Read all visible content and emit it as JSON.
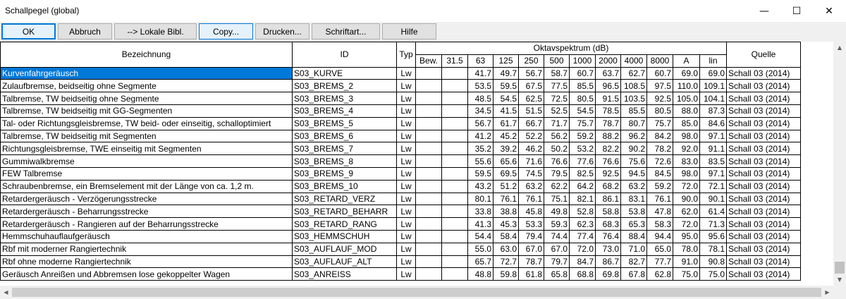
{
  "window": {
    "title": "Schallpegel (global)",
    "minimize_glyph": "—",
    "maximize_glyph": "☐",
    "close_glyph": "✕"
  },
  "toolbar": {
    "ok": "OK",
    "abbruch": "Abbruch",
    "lokale_bibl": "--> Lokale Bibl.",
    "copy": "Copy...",
    "drucken": "Drucken...",
    "schriftart": "Schriftart...",
    "hilfe": "Hilfe"
  },
  "table": {
    "headers": {
      "bezeichnung": "Bezeichnung",
      "id": "ID",
      "typ": "Typ",
      "oktav": "Oktavspektrum (dB)",
      "quelle": "Quelle"
    },
    "subheaders": [
      "Bew.",
      "31.5",
      "63",
      "125",
      "250",
      "500",
      "1000",
      "2000",
      "4000",
      "8000",
      "A",
      "lin"
    ],
    "rows": [
      {
        "name": "Kurvenfahrgeräusch",
        "id": "S03_KURVE",
        "typ": "Lw",
        "bew": "",
        "f31": "",
        "f63": "41.7",
        "f125": "49.7",
        "f250": "56.7",
        "f500": "58.7",
        "f1000": "60.7",
        "f2000": "63.7",
        "f4000": "62.7",
        "f8000": "60.7",
        "a": "69.0",
        "lin": "69.0",
        "quelle": "Schall 03 (2014)"
      },
      {
        "name": "Zulaufbremse, beidseitig ohne Segmente",
        "id": "S03_BREMS_2",
        "typ": "Lw",
        "bew": "",
        "f31": "",
        "f63": "53.5",
        "f125": "59.5",
        "f250": "67.5",
        "f500": "77.5",
        "f1000": "85.5",
        "f2000": "96.5",
        "f4000": "108.5",
        "f8000": "97.5",
        "a": "110.0",
        "lin": "109.1",
        "quelle": "Schall 03 (2014)"
      },
      {
        "name": "Talbremse, TW beidseitig ohne Segmente",
        "id": "S03_BREMS_3",
        "typ": "Lw",
        "bew": "",
        "f31": "",
        "f63": "48.5",
        "f125": "54.5",
        "f250": "62.5",
        "f500": "72.5",
        "f1000": "80.5",
        "f2000": "91.5",
        "f4000": "103.5",
        "f8000": "92.5",
        "a": "105.0",
        "lin": "104.1",
        "quelle": "Schall 03 (2014)"
      },
      {
        "name": "Talbremse, TW beidseitig mit GG-Segmenten",
        "id": "S03_BREMS_4",
        "typ": "Lw",
        "bew": "",
        "f31": "",
        "f63": "34.5",
        "f125": "41.5",
        "f250": "51.5",
        "f500": "52.5",
        "f1000": "54.5",
        "f2000": "78.5",
        "f4000": "85.5",
        "f8000": "80.5",
        "a": "88.0",
        "lin": "87.3",
        "quelle": "Schall 03 (2014)"
      },
      {
        "name": "Tal- oder Richtungsgleisbremse, TW beid- oder einseitig, schalloptimiert",
        "id": "S03_BREMS_5",
        "typ": "Lw",
        "bew": "",
        "f31": "",
        "f63": "56.7",
        "f125": "61.7",
        "f250": "66.7",
        "f500": "71.7",
        "f1000": "75.7",
        "f2000": "78.7",
        "f4000": "80.7",
        "f8000": "75.7",
        "a": "85.0",
        "lin": "84.6",
        "quelle": "Schall 03 (2014)"
      },
      {
        "name": "Talbremse, TW beidseitig mit Segmenten",
        "id": "S03_BREMS_6",
        "typ": "Lw",
        "bew": "",
        "f31": "",
        "f63": "41.2",
        "f125": "45.2",
        "f250": "52.2",
        "f500": "56.2",
        "f1000": "59.2",
        "f2000": "88.2",
        "f4000": "96.2",
        "f8000": "84.2",
        "a": "98.0",
        "lin": "97.1",
        "quelle": "Schall 03 (2014)"
      },
      {
        "name": "Richtungsgleisbremse, TWE einseitig mit Segmenten",
        "id": "S03_BREMS_7",
        "typ": "Lw",
        "bew": "",
        "f31": "",
        "f63": "35.2",
        "f125": "39.2",
        "f250": "46.2",
        "f500": "50.2",
        "f1000": "53.2",
        "f2000": "82.2",
        "f4000": "90.2",
        "f8000": "78.2",
        "a": "92.0",
        "lin": "91.1",
        "quelle": "Schall 03 (2014)"
      },
      {
        "name": "Gummiwalkbremse",
        "id": "S03_BREMS_8",
        "typ": "Lw",
        "bew": "",
        "f31": "",
        "f63": "55.6",
        "f125": "65.6",
        "f250": "71.6",
        "f500": "76.6",
        "f1000": "77.6",
        "f2000": "76.6",
        "f4000": "75.6",
        "f8000": "72.6",
        "a": "83.0",
        "lin": "83.5",
        "quelle": "Schall 03 (2014)"
      },
      {
        "name": "FEW Talbremse",
        "id": "S03_BREMS_9",
        "typ": "Lw",
        "bew": "",
        "f31": "",
        "f63": "59.5",
        "f125": "69.5",
        "f250": "74.5",
        "f500": "79.5",
        "f1000": "82.5",
        "f2000": "92.5",
        "f4000": "94.5",
        "f8000": "84.5",
        "a": "98.0",
        "lin": "97.1",
        "quelle": "Schall 03 (2014)"
      },
      {
        "name": "Schraubenbremse, ein Bremselement mit der Länge von ca. 1,2 m.",
        "id": "S03_BREMS_10",
        "typ": "Lw",
        "bew": "",
        "f31": "",
        "f63": "43.2",
        "f125": "51.2",
        "f250": "63.2",
        "f500": "62.2",
        "f1000": "64.2",
        "f2000": "68.2",
        "f4000": "63.2",
        "f8000": "59.2",
        "a": "72.0",
        "lin": "72.1",
        "quelle": "Schall 03 (2014)"
      },
      {
        "name": "Retardergeräusch - Verzögerungsstrecke",
        "id": "S03_RETARD_VERZ",
        "typ": "Lw",
        "bew": "",
        "f31": "",
        "f63": "80.1",
        "f125": "76.1",
        "f250": "76.1",
        "f500": "75.1",
        "f1000": "82.1",
        "f2000": "86.1",
        "f4000": "83.1",
        "f8000": "76.1",
        "a": "90.0",
        "lin": "90.1",
        "quelle": "Schall 03 (2014)"
      },
      {
        "name": "Retardergeräusch - Beharrungsstrecke",
        "id": "S03_RETARD_BEHARR",
        "typ": "Lw",
        "bew": "",
        "f31": "",
        "f63": "33.8",
        "f125": "38.8",
        "f250": "45.8",
        "f500": "49.8",
        "f1000": "52.8",
        "f2000": "58.8",
        "f4000": "53.8",
        "f8000": "47.8",
        "a": "62.0",
        "lin": "61.4",
        "quelle": "Schall 03 (2014)"
      },
      {
        "name": "Retardergeräusch - Rangieren auf der Beharrungsstrecke",
        "id": "S03_RETARD_RANG",
        "typ": "Lw",
        "bew": "",
        "f31": "",
        "f63": "41.3",
        "f125": "45.3",
        "f250": "53.3",
        "f500": "59.3",
        "f1000": "62.3",
        "f2000": "68.3",
        "f4000": "65.3",
        "f8000": "58.3",
        "a": "72.0",
        "lin": "71.3",
        "quelle": "Schall 03 (2014)"
      },
      {
        "name": "Hemmschuhauflaufgeräusch",
        "id": "S03_HEMMSCHUH",
        "typ": "Lw",
        "bew": "",
        "f31": "",
        "f63": "54.4",
        "f125": "58.4",
        "f250": "79.4",
        "f500": "74.4",
        "f1000": "77.4",
        "f2000": "76.4",
        "f4000": "88.4",
        "f8000": "94.4",
        "a": "95.0",
        "lin": "95.6",
        "quelle": "Schall 03 (2014)"
      },
      {
        "name": "Rbf mit moderner Rangiertechnik",
        "id": "S03_AUFLAUF_MOD",
        "typ": "Lw",
        "bew": "",
        "f31": "",
        "f63": "55.0",
        "f125": "63.0",
        "f250": "67.0",
        "f500": "67.0",
        "f1000": "72.0",
        "f2000": "73.0",
        "f4000": "71.0",
        "f8000": "65.0",
        "a": "78.0",
        "lin": "78.1",
        "quelle": "Schall 03 (2014)"
      },
      {
        "name": "Rbf ohne moderne Rangiertechnik",
        "id": "S03_AUFLAUF_ALT",
        "typ": "Lw",
        "bew": "",
        "f31": "",
        "f63": "65.7",
        "f125": "72.7",
        "f250": "78.7",
        "f500": "79.7",
        "f1000": "84.7",
        "f2000": "86.7",
        "f4000": "82.7",
        "f8000": "77.7",
        "a": "91.0",
        "lin": "90.8",
        "quelle": "Schall 03 (2014)"
      },
      {
        "name": "Geräusch Anreißen und Abbremsen lose gekoppelter Wagen",
        "id": "S03_ANREISS",
        "typ": "Lw",
        "bew": "",
        "f31": "",
        "f63": "48.8",
        "f125": "59.8",
        "f250": "61.8",
        "f500": "65.8",
        "f1000": "68.8",
        "f2000": "69.8",
        "f4000": "67.8",
        "f8000": "62.8",
        "a": "75.0",
        "lin": "75.0",
        "quelle": "Schall 03 (2014)"
      }
    ]
  },
  "scroll": {
    "up": "▲",
    "down": "▼",
    "left": "◀",
    "right": "▶"
  }
}
